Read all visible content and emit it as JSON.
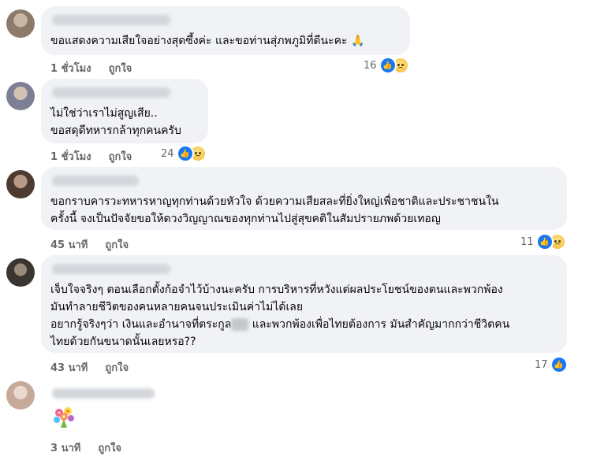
{
  "comments": [
    {
      "text": "ขอแสดงความเสียใจอย่างสุดซึ้งค่ะ และขอท่านสุ่ภพภูมิที่ดีนะคะ 🙏",
      "time": "1 ชั่วโมง",
      "like_label": "ถูกใจ",
      "reaction_count": "16",
      "reactions": [
        "like-icon",
        "sad-icon"
      ]
    },
    {
      "text": "ไม่ใช่ว่าเราไม่สูญเสีย..\nขอสดุดีทหารกล้าทุกคนครับ",
      "time": "1 ชั่วโมง",
      "like_label": "ถูกใจ",
      "reaction_count": "24",
      "reactions": [
        "like-icon",
        "sad-icon"
      ]
    },
    {
      "text": "ขอกราบคารวะทหารหาญทุกท่านด้วยหัวใจ ด้วยความเสียสละที่ยิ่งใหญ่เพื่อชาติและประชาชนใน\nครั้งนี้ จงเป็นปัจจัยขอให้ดวงวิญญาณของทุกท่านไปสู่สุขคติในสัมปรายภพด้วยเทอญ",
      "time": "45 นาที",
      "like_label": "ถูกใจ",
      "reaction_count": "11",
      "reactions": [
        "like-icon",
        "sad-icon"
      ]
    },
    {
      "text_a": "เจ็บใจจริงๆ ตอนเลือกตั้งก้อจำไว้บ้างนะครับ การบริหารที่หวังแต่ผลประโยชน์ของตนและพวกพ้อง\nมันทำลายชีวิตของคนหลายคนจนประเมินค่าไม่ได้เลย\nอยากรู้จริงๆว่า เงินและอำนาจที่ตระกูล",
      "text_b": " และพวกพ้องเพื่อไทยต้องการ มันสำคัญมากกว่าชีวิตคน\nไทยด้วยกันขนาดนั้นเลยหรอ??",
      "time": "43 นาที",
      "like_label": "ถูกใจ",
      "reaction_count": "17",
      "reactions": [
        "like-icon"
      ]
    },
    {
      "sticker": "flower-bouquet-icon",
      "time": "3 นาที",
      "like_label": "ถูกใจ"
    }
  ],
  "colors": {
    "bubble": "#f0f2f5",
    "meta": "#65676b",
    "like": "#1877f2"
  }
}
